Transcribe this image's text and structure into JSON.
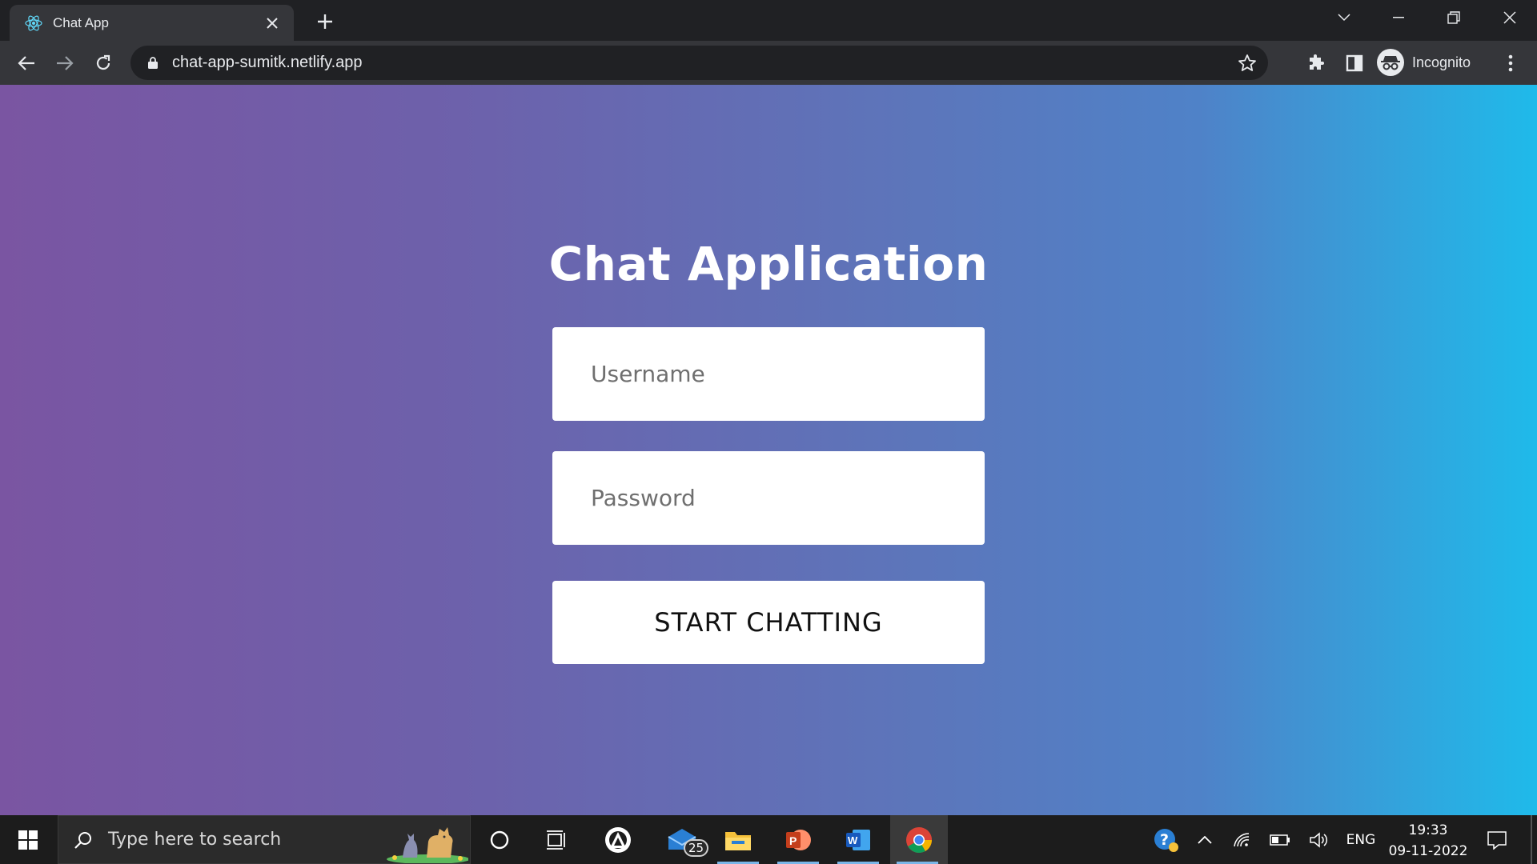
{
  "browser": {
    "tab_title": "Chat App",
    "url": "chat-app-sumitk.netlify.app",
    "profile_label": "Incognito"
  },
  "page": {
    "title": "Chat Application",
    "username_placeholder": "Username",
    "password_placeholder": "Password",
    "start_button_label": "START CHATTING"
  },
  "taskbar": {
    "search_placeholder": "Type here to search",
    "mail_badge": "25",
    "language": "ENG",
    "time": "19:33",
    "date": "09-11-2022"
  },
  "colors": {
    "gradient_start": "#7a55a2",
    "gradient_end": "#1fbaea"
  }
}
